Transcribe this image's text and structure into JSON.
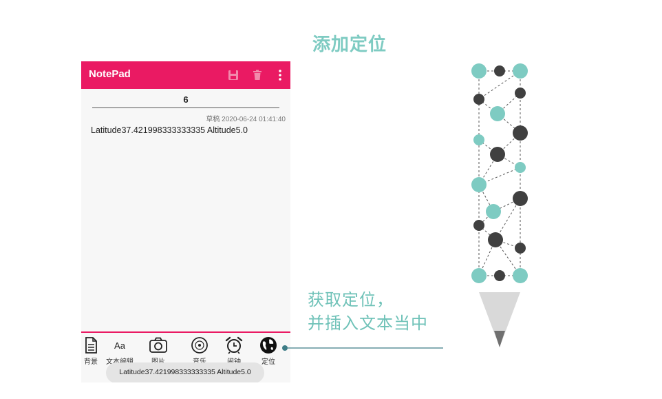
{
  "slide": {
    "title": "添加定位",
    "callout_line1": "获取定位，",
    "callout_line2": "并插入文本当中"
  },
  "app": {
    "title": "NotePad",
    "actions": [
      "save-icon",
      "delete-icon",
      "more-vert-icon"
    ],
    "accent_color": "#ea1a63"
  },
  "note": {
    "title": "6",
    "timestamp": "草稿 2020-06-24 01:41:40",
    "body": "Latitude37.421998333333335 Altitude5.0"
  },
  "toolbar": {
    "items": [
      {
        "label": "背景",
        "icon": "document-icon"
      },
      {
        "label": "文本编辑",
        "icon": "text-format-icon"
      },
      {
        "label": "图片",
        "icon": "camera-icon"
      },
      {
        "label": "音乐",
        "icon": "music-disc-icon"
      },
      {
        "label": "闹钟",
        "icon": "alarm-clock-icon"
      },
      {
        "label": "定位",
        "icon": "globe-icon"
      }
    ]
  },
  "toast": {
    "text": "Latitude37.421998333333335 Altitude5.0"
  },
  "decor": {
    "teal": "#7ecbc2",
    "dark": "#404040"
  }
}
